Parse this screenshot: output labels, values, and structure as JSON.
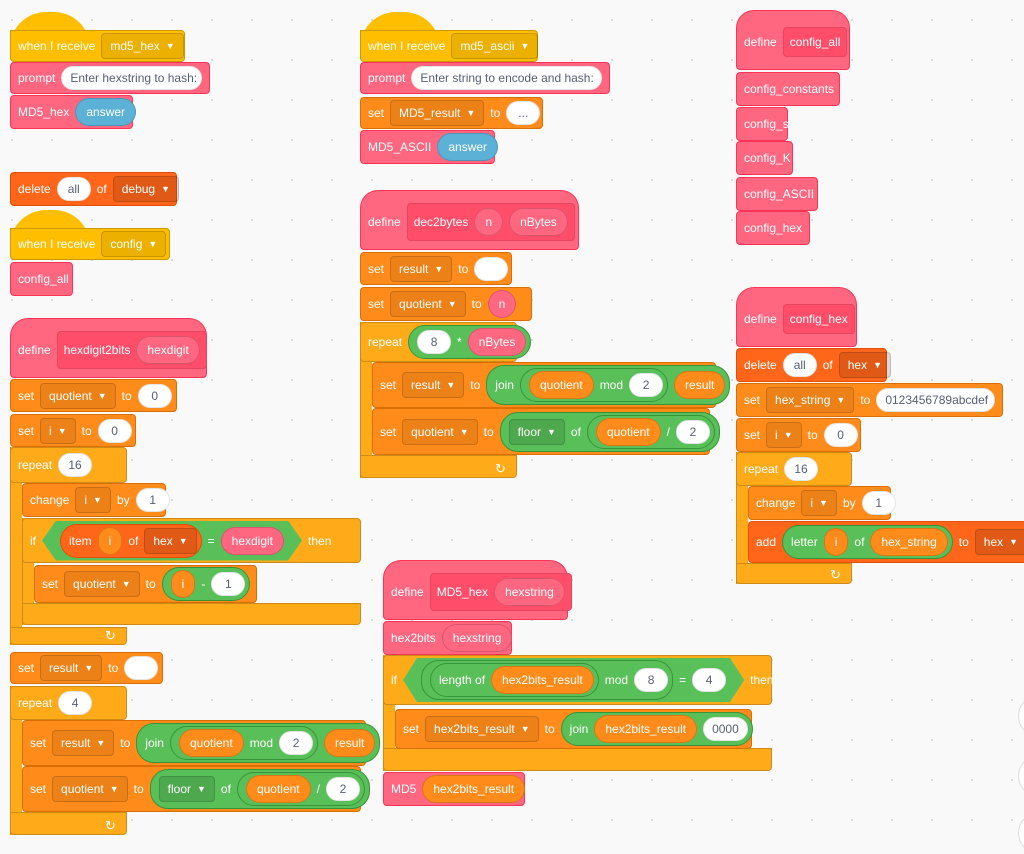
{
  "categories": {
    "events": "#FFBF00",
    "myblocks": "#FF6680",
    "variables": "#FF8C1A",
    "lists": "#FF661A",
    "control": "#FFAB19",
    "operators": "#59C059",
    "sensing": "#5CB1D6"
  },
  "loop_icon": "loop-arrow-icon",
  "blocks": [
    {
      "cat": "events",
      "kind": "hat",
      "tokens": [
        {
          "t": "label",
          "v": "when I receive"
        },
        {
          "t": "dd",
          "v": "md5_hex"
        }
      ]
    },
    {
      "cat": "myblocks",
      "tokens": [
        {
          "t": "label",
          "v": "prompt"
        },
        {
          "t": "input",
          "v": "Enter hexstring to hash:"
        }
      ]
    },
    {
      "cat": "myblocks",
      "tokens": [
        {
          "t": "label",
          "v": "MD5_hex"
        },
        {
          "t": "var",
          "c": "sensing",
          "v": "answer"
        }
      ]
    },
    {
      "cat": "lists",
      "tokens": [
        {
          "t": "label",
          "v": "delete"
        },
        {
          "t": "input",
          "v": "all"
        },
        {
          "t": "label",
          "v": "of"
        },
        {
          "t": "dd",
          "v": "debug"
        }
      ]
    },
    {
      "cat": "events",
      "kind": "hat",
      "tokens": [
        {
          "t": "label",
          "v": "when I receive"
        },
        {
          "t": "dd",
          "v": "config"
        }
      ]
    },
    {
      "cat": "myblocks",
      "tokens": [
        {
          "t": "label",
          "v": "config_all"
        }
      ]
    },
    {
      "cat": "myblocks",
      "kind": "define",
      "tokens": [
        {
          "t": "label",
          "v": "define"
        },
        {
          "t": "proto",
          "items": [
            {
              "t": "label",
              "v": "hexdigit2bits"
            },
            {
              "t": "var",
              "c": "myblocks",
              "v": "hexdigit"
            }
          ]
        }
      ]
    },
    {
      "cat": "variables",
      "tokens": [
        {
          "t": "label",
          "v": "set"
        },
        {
          "t": "dd",
          "v": "quotient"
        },
        {
          "t": "label",
          "v": "to"
        },
        {
          "t": "input",
          "v": "0"
        }
      ]
    },
    {
      "cat": "variables",
      "tokens": [
        {
          "t": "label",
          "v": "set"
        },
        {
          "t": "dd",
          "v": "i"
        },
        {
          "t": "label",
          "v": "to"
        },
        {
          "t": "input",
          "v": "0"
        }
      ]
    },
    {
      "cat": "control",
      "tokens": [
        {
          "t": "label",
          "v": "repeat"
        },
        {
          "t": "input",
          "v": "16"
        }
      ]
    },
    {
      "cat": "variables",
      "tokens": [
        {
          "t": "label",
          "v": "change"
        },
        {
          "t": "dd",
          "v": "i"
        },
        {
          "t": "label",
          "v": "by"
        },
        {
          "t": "input",
          "v": "1"
        }
      ]
    },
    {
      "cat": "control",
      "tokens": [
        {
          "t": "label",
          "v": "if"
        },
        {
          "t": "bool",
          "c": "operators",
          "items": [
            {
              "t": "rep",
              "c": "lists",
              "items": [
                {
                  "t": "label",
                  "v": "item"
                },
                {
                  "t": "var",
                  "c": "variables",
                  "v": "i"
                },
                {
                  "t": "label",
                  "v": "of"
                },
                {
                  "t": "dd",
                  "v": "hex"
                }
              ]
            },
            {
              "t": "label",
              "v": "="
            },
            {
              "t": "var",
              "c": "myblocks",
              "v": "hexdigit"
            }
          ]
        },
        {
          "t": "label",
          "v": "then"
        }
      ]
    },
    {
      "cat": "variables",
      "tokens": [
        {
          "t": "label",
          "v": "set"
        },
        {
          "t": "dd",
          "v": "quotient"
        },
        {
          "t": "label",
          "v": "to"
        },
        {
          "t": "rep",
          "c": "operators",
          "items": [
            {
              "t": "var",
              "c": "variables",
              "v": "i"
            },
            {
              "t": "label",
              "v": "-"
            },
            {
              "t": "input",
              "v": "1"
            }
          ]
        }
      ]
    },
    {
      "cat": "variables",
      "tokens": [
        {
          "t": "label",
          "v": "set"
        },
        {
          "t": "dd",
          "v": "result"
        },
        {
          "t": "label",
          "v": "to"
        },
        {
          "t": "input",
          "v": ""
        }
      ]
    },
    {
      "cat": "control",
      "tokens": [
        {
          "t": "label",
          "v": "repeat"
        },
        {
          "t": "input",
          "v": "4"
        }
      ]
    },
    {
      "cat": "variables",
      "tokens": [
        {
          "t": "label",
          "v": "set"
        },
        {
          "t": "dd",
          "v": "result"
        },
        {
          "t": "label",
          "v": "to"
        },
        {
          "t": "rep",
          "c": "operators",
          "items": [
            {
              "t": "label",
              "v": "join"
            },
            {
              "t": "rep",
              "c": "operators",
              "items": [
                {
                  "t": "var",
                  "c": "variables",
                  "v": "quotient"
                },
                {
                  "t": "label",
                  "v": "mod"
                },
                {
                  "t": "input",
                  "v": "2"
                }
              ]
            },
            {
              "t": "var",
              "c": "variables",
              "v": "result"
            }
          ]
        }
      ]
    },
    {
      "cat": "variables",
      "tokens": [
        {
          "t": "label",
          "v": "set"
        },
        {
          "t": "dd",
          "v": "quotient"
        },
        {
          "t": "label",
          "v": "to"
        },
        {
          "t": "rep",
          "c": "operators",
          "items": [
            {
              "t": "dd",
              "v": "floor"
            },
            {
              "t": "label",
              "v": "of"
            },
            {
              "t": "rep",
              "c": "operators",
              "items": [
                {
                  "t": "var",
                  "c": "variables",
                  "v": "quotient"
                },
                {
                  "t": "label",
                  "v": "/"
                },
                {
                  "t": "input",
                  "v": "2"
                }
              ]
            }
          ]
        }
      ]
    },
    {
      "cat": "events",
      "kind": "hat",
      "tokens": [
        {
          "t": "label",
          "v": "when I receive"
        },
        {
          "t": "dd",
          "v": "md5_ascii"
        }
      ]
    },
    {
      "cat": "myblocks",
      "tokens": [
        {
          "t": "label",
          "v": "prompt"
        },
        {
          "t": "input",
          "v": "Enter string to encode and hash:"
        }
      ]
    },
    {
      "cat": "variables",
      "tokens": [
        {
          "t": "label",
          "v": "set"
        },
        {
          "t": "dd",
          "v": "MD5_result"
        },
        {
          "t": "label",
          "v": "to"
        },
        {
          "t": "input",
          "v": "..."
        }
      ]
    },
    {
      "cat": "myblocks",
      "tokens": [
        {
          "t": "label",
          "v": "MD5_ASCII"
        },
        {
          "t": "var",
          "c": "sensing",
          "v": "answer"
        }
      ]
    },
    {
      "cat": "myblocks",
      "kind": "define",
      "tokens": [
        {
          "t": "label",
          "v": "define"
        },
        {
          "t": "proto",
          "items": [
            {
              "t": "label",
              "v": "dec2bytes"
            },
            {
              "t": "var",
              "c": "myblocks",
              "v": "n"
            },
            {
              "t": "var",
              "c": "myblocks",
              "v": "nBytes"
            }
          ]
        }
      ]
    },
    {
      "cat": "variables",
      "tokens": [
        {
          "t": "label",
          "v": "set"
        },
        {
          "t": "dd",
          "v": "result"
        },
        {
          "t": "label",
          "v": "to"
        },
        {
          "t": "input",
          "v": ""
        }
      ]
    },
    {
      "cat": "variables",
      "tokens": [
        {
          "t": "label",
          "v": "set"
        },
        {
          "t": "dd",
          "v": "quotient"
        },
        {
          "t": "label",
          "v": "to"
        },
        {
          "t": "var",
          "c": "myblocks",
          "v": "n"
        }
      ]
    },
    {
      "cat": "control",
      "tokens": [
        {
          "t": "label",
          "v": "repeat"
        },
        {
          "t": "rep",
          "c": "operators",
          "items": [
            {
              "t": "input",
              "v": "8"
            },
            {
              "t": "label",
              "v": "*"
            },
            {
              "t": "var",
              "c": "myblocks",
              "v": "nBytes"
            }
          ]
        }
      ]
    },
    {
      "cat": "variables",
      "tokens": [
        {
          "t": "label",
          "v": "set"
        },
        {
          "t": "dd",
          "v": "result"
        },
        {
          "t": "label",
          "v": "to"
        },
        {
          "t": "rep",
          "c": "operators",
          "items": [
            {
              "t": "label",
              "v": "join"
            },
            {
              "t": "rep",
              "c": "operators",
              "items": [
                {
                  "t": "var",
                  "c": "variables",
                  "v": "quotient"
                },
                {
                  "t": "label",
                  "v": "mod"
                },
                {
                  "t": "input",
                  "v": "2"
                }
              ]
            },
            {
              "t": "var",
              "c": "variables",
              "v": "result"
            }
          ]
        }
      ]
    },
    {
      "cat": "variables",
      "tokens": [
        {
          "t": "label",
          "v": "set"
        },
        {
          "t": "dd",
          "v": "quotient"
        },
        {
          "t": "label",
          "v": "to"
        },
        {
          "t": "rep",
          "c": "operators",
          "items": [
            {
              "t": "dd",
              "v": "floor"
            },
            {
              "t": "label",
              "v": "of"
            },
            {
              "t": "rep",
              "c": "operators",
              "items": [
                {
                  "t": "var",
                  "c": "variables",
                  "v": "quotient"
                },
                {
                  "t": "label",
                  "v": "/"
                },
                {
                  "t": "input",
                  "v": "2"
                }
              ]
            }
          ]
        }
      ]
    },
    {
      "cat": "myblocks",
      "kind": "define",
      "tokens": [
        {
          "t": "label",
          "v": "define"
        },
        {
          "t": "proto",
          "items": [
            {
              "t": "label",
              "v": "MD5_hex"
            },
            {
              "t": "var",
              "c": "myblocks",
              "v": "hexstring"
            }
          ]
        }
      ]
    },
    {
      "cat": "myblocks",
      "tokens": [
        {
          "t": "label",
          "v": "hex2bits"
        },
        {
          "t": "var",
          "c": "myblocks",
          "v": "hexstring"
        }
      ]
    },
    {
      "cat": "control",
      "tokens": [
        {
          "t": "label",
          "v": "if"
        },
        {
          "t": "bool",
          "c": "operators",
          "items": [
            {
              "t": "rep",
              "c": "operators",
              "items": [
                {
                  "t": "rep",
                  "c": "operators",
                  "items": [
                    {
                      "t": "label",
                      "v": "length of"
                    },
                    {
                      "t": "var",
                      "c": "variables",
                      "v": "hex2bits_result"
                    }
                  ]
                },
                {
                  "t": "label",
                  "v": "mod"
                },
                {
                  "t": "input",
                  "v": "8"
                }
              ]
            },
            {
              "t": "label",
              "v": "="
            },
            {
              "t": "input",
              "v": "4"
            }
          ]
        },
        {
          "t": "label",
          "v": "then"
        }
      ]
    },
    {
      "cat": "variables",
      "tokens": [
        {
          "t": "label",
          "v": "set"
        },
        {
          "t": "dd",
          "v": "hex2bits_result"
        },
        {
          "t": "label",
          "v": "to"
        },
        {
          "t": "rep",
          "c": "operators",
          "items": [
            {
              "t": "label",
              "v": "join"
            },
            {
              "t": "var",
              "c": "variables",
              "v": "hex2bits_result"
            },
            {
              "t": "input",
              "v": "0000"
            }
          ]
        }
      ]
    },
    {
      "cat": "myblocks",
      "tokens": [
        {
          "t": "label",
          "v": "MD5"
        },
        {
          "t": "var",
          "c": "variables",
          "v": "hex2bits_result"
        }
      ]
    },
    {
      "cat": "myblocks",
      "kind": "define",
      "tokens": [
        {
          "t": "label",
          "v": "define"
        },
        {
          "t": "proto",
          "items": [
            {
              "t": "label",
              "v": "config_all"
            }
          ]
        }
      ]
    },
    {
      "cat": "myblocks",
      "tokens": [
        {
          "t": "label",
          "v": "config_constants"
        }
      ]
    },
    {
      "cat": "myblocks",
      "tokens": [
        {
          "t": "label",
          "v": "config_s"
        }
      ]
    },
    {
      "cat": "myblocks",
      "tokens": [
        {
          "t": "label",
          "v": "config_K"
        }
      ]
    },
    {
      "cat": "myblocks",
      "tokens": [
        {
          "t": "label",
          "v": "config_ASCII"
        }
      ]
    },
    {
      "cat": "myblocks",
      "tokens": [
        {
          "t": "label",
          "v": "config_hex"
        }
      ]
    },
    {
      "cat": "myblocks",
      "kind": "define",
      "tokens": [
        {
          "t": "label",
          "v": "define"
        },
        {
          "t": "proto",
          "items": [
            {
              "t": "label",
              "v": "config_hex"
            }
          ]
        }
      ]
    },
    {
      "cat": "lists",
      "tokens": [
        {
          "t": "label",
          "v": "delete"
        },
        {
          "t": "input",
          "v": "all"
        },
        {
          "t": "label",
          "v": "of"
        },
        {
          "t": "dd",
          "v": "hex"
        }
      ]
    },
    {
      "cat": "variables",
      "tokens": [
        {
          "t": "label",
          "v": "set"
        },
        {
          "t": "dd",
          "v": "hex_string"
        },
        {
          "t": "label",
          "v": "to"
        },
        {
          "t": "input",
          "v": "0123456789abcdef"
        }
      ]
    },
    {
      "cat": "variables",
      "tokens": [
        {
          "t": "label",
          "v": "set"
        },
        {
          "t": "dd",
          "v": "i"
        },
        {
          "t": "label",
          "v": "to"
        },
        {
          "t": "input",
          "v": "0"
        }
      ]
    },
    {
      "cat": "control",
      "tokens": [
        {
          "t": "label",
          "v": "repeat"
        },
        {
          "t": "input",
          "v": "16"
        }
      ]
    },
    {
      "cat": "variables",
      "tokens": [
        {
          "t": "label",
          "v": "change"
        },
        {
          "t": "dd",
          "v": "i"
        },
        {
          "t": "label",
          "v": "by"
        },
        {
          "t": "input",
          "v": "1"
        }
      ]
    },
    {
      "cat": "lists",
      "tokens": [
        {
          "t": "label",
          "v": "add"
        },
        {
          "t": "rep",
          "c": "operators",
          "items": [
            {
              "t": "label",
              "v": "letter"
            },
            {
              "t": "var",
              "c": "variables",
              "v": "i"
            },
            {
              "t": "label",
              "v": "of"
            },
            {
              "t": "var",
              "c": "variables",
              "v": "hex_string"
            }
          ]
        },
        {
          "t": "label",
          "v": "to"
        },
        {
          "t": "dd",
          "v": "hex"
        }
      ]
    }
  ]
}
